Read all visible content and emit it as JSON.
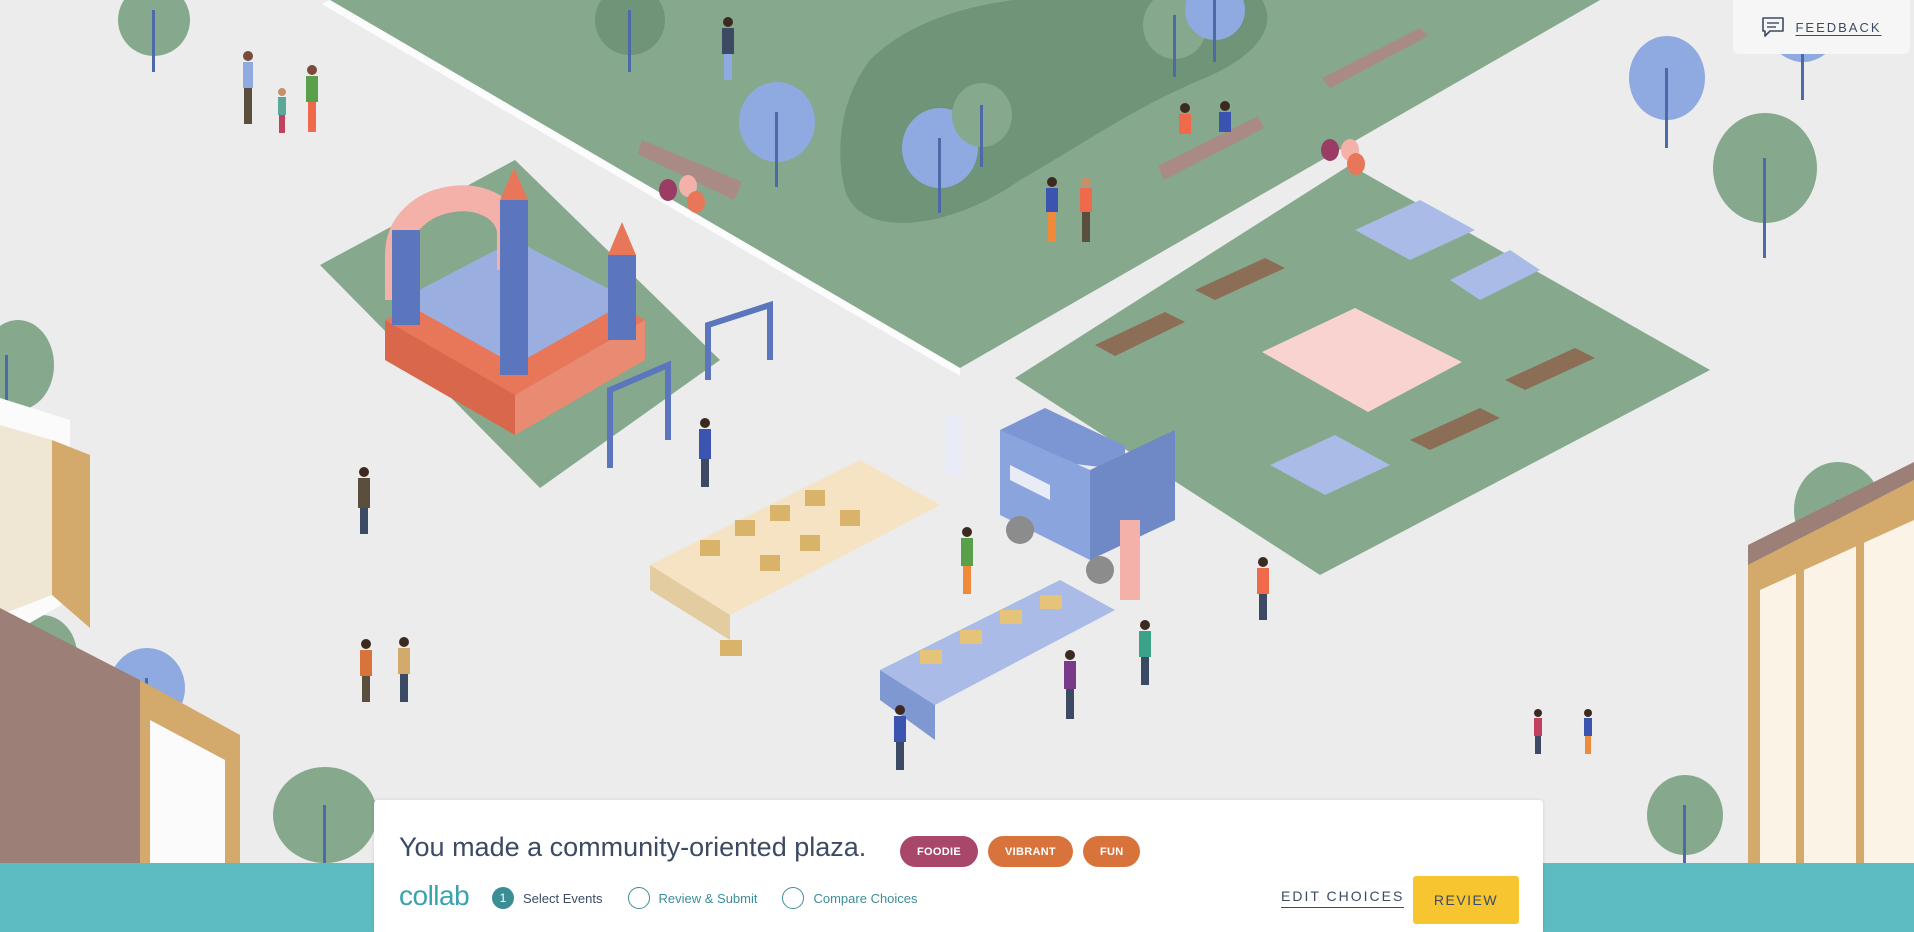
{
  "feedback": {
    "label": "FEEDBACK",
    "icon": "comment-icon"
  },
  "summary": {
    "text": "You made a community-oriented plaza."
  },
  "tags": [
    {
      "label": "FOODIE",
      "color": "#a9476b"
    },
    {
      "label": "VIBRANT",
      "color": "#d9733c"
    },
    {
      "label": "FUN",
      "color": "#d9733c"
    }
  ],
  "brand": {
    "logo": "collab"
  },
  "steps": [
    {
      "number": "1",
      "label": "Select Events",
      "state": "current"
    },
    {
      "number": "",
      "label": "Review & Submit",
      "state": "upcoming"
    },
    {
      "number": "",
      "label": "Compare Choices",
      "state": "upcoming"
    }
  ],
  "actions": {
    "edit_label": "EDIT CHOICES",
    "review_label": "REVIEW"
  },
  "colors": {
    "background": "#ececec",
    "lawn": "#86a88c",
    "bottom_strip": "#5dbcc2",
    "accent_teal": "#3c8e96",
    "review_button": "#f7c52f",
    "text_dark": "#3c4b63"
  }
}
